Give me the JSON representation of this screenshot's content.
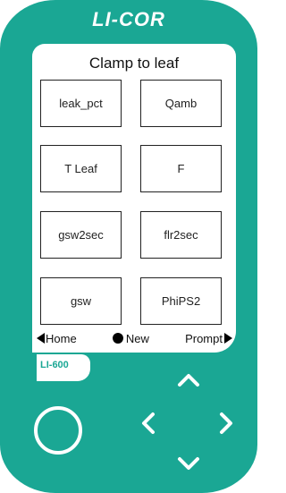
{
  "device": {
    "brand": "LI-COR",
    "model": "LI-600"
  },
  "screen": {
    "title": "Clamp to leaf",
    "cells": [
      "leak_pct",
      "Qamb",
      "T Leaf",
      "F",
      "gsw2sec",
      "flr2sec",
      "gsw",
      "PhiPS2"
    ],
    "softkeys": {
      "left": "Home",
      "center": "New",
      "right": "Prompt"
    }
  },
  "colors": {
    "body": "#1aa794",
    "screen": "#ffffff"
  },
  "icons": {
    "softkey_left": "triangle-left-icon",
    "softkey_center": "filled-circle-icon",
    "softkey_right": "triangle-right-icon",
    "dpad": [
      "chevron-up-icon",
      "chevron-down-icon",
      "chevron-left-icon",
      "chevron-right-icon"
    ],
    "power": "circle-button-icon"
  }
}
